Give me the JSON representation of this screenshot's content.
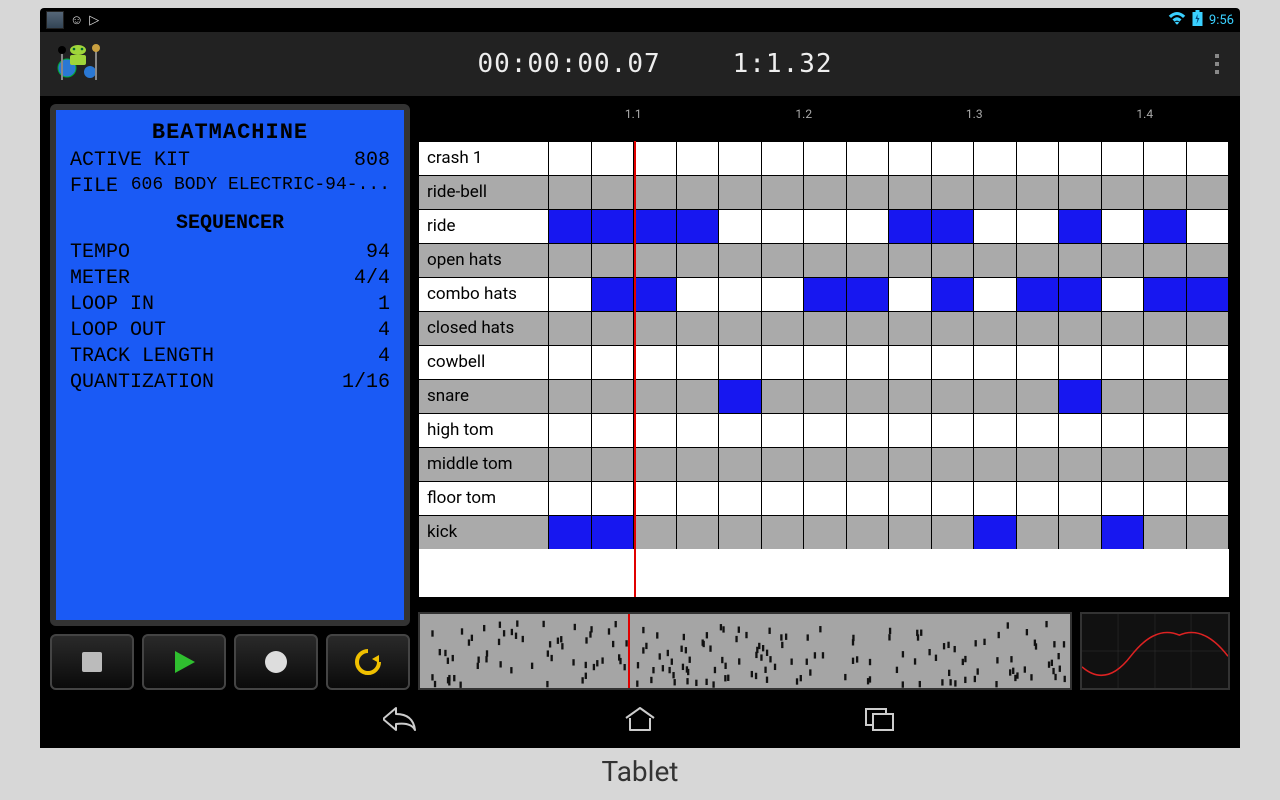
{
  "caption": "Tablet",
  "statusbar": {
    "time": "9:56"
  },
  "actionbar": {
    "elapsed": "00:00:00.07",
    "position": "1:1.32"
  },
  "lcd": {
    "title": "BEATMACHINE",
    "active_kit_label": "ACTIVE KIT",
    "active_kit_value": "808",
    "file_label": "FILE",
    "file_value": "606 BODY ELECTRIC-94-...",
    "section2": "SEQUENCER",
    "tempo_label": "TEMPO",
    "tempo_value": "94",
    "meter_label": "METER",
    "meter_value": "4/4",
    "loopin_label": "LOOP IN",
    "loopin_value": "1",
    "loopout_label": "LOOP OUT",
    "loopout_value": "4",
    "tracklen_label": "TRACK LENGTH",
    "tracklen_value": "4",
    "quant_label": "QUANTIZATION",
    "quant_value": "1/16"
  },
  "timeline": {
    "t1": "1.1",
    "t2": "1.2",
    "t3": "1.3",
    "t4": "1.4"
  },
  "tracks": {
    "r0": "crash 1",
    "r1": "ride-bell",
    "r2": "ride",
    "r3": "open hats",
    "r4": "combo hats",
    "r5": "closed hats",
    "r6": "cowbell",
    "r7": "snare",
    "r8": "high tom",
    "r9": "middle tom",
    "r10": "floor tom",
    "r11": "kick"
  },
  "chart_data": {
    "type": "table",
    "title": "Drum sequencer pattern (1 bar, 1/16 resolution)",
    "columns_per_beat": 4,
    "beats": 4,
    "steps": 16,
    "tracks": [
      {
        "name": "crash 1",
        "steps": [
          0,
          0,
          0,
          0,
          0,
          0,
          0,
          0,
          0,
          0,
          0,
          0,
          0,
          0,
          0,
          0
        ]
      },
      {
        "name": "ride-bell",
        "steps": [
          0,
          0,
          0,
          0,
          0,
          0,
          0,
          0,
          0,
          0,
          0,
          0,
          0,
          0,
          0,
          0
        ]
      },
      {
        "name": "ride",
        "steps": [
          1,
          1,
          1,
          1,
          0,
          0,
          0,
          0,
          1,
          1,
          0,
          0,
          1,
          0,
          1,
          0
        ]
      },
      {
        "name": "open hats",
        "steps": [
          0,
          0,
          0,
          0,
          0,
          0,
          0,
          0,
          0,
          0,
          0,
          0,
          0,
          0,
          0,
          0
        ]
      },
      {
        "name": "combo hats",
        "steps": [
          0,
          1,
          1,
          0,
          0,
          0,
          1,
          1,
          0,
          1,
          0,
          1,
          1,
          0,
          1,
          1
        ]
      },
      {
        "name": "closed hats",
        "steps": [
          0,
          0,
          0,
          0,
          0,
          0,
          0,
          0,
          0,
          0,
          0,
          0,
          0,
          0,
          0,
          0
        ]
      },
      {
        "name": "cowbell",
        "steps": [
          0,
          0,
          0,
          0,
          0,
          0,
          0,
          0,
          0,
          0,
          0,
          0,
          0,
          0,
          0,
          0
        ]
      },
      {
        "name": "snare",
        "steps": [
          0,
          0,
          0,
          0,
          1,
          0,
          0,
          0,
          0,
          0,
          0,
          0,
          1,
          0,
          0,
          0
        ]
      },
      {
        "name": "high tom",
        "steps": [
          0,
          0,
          0,
          0,
          0,
          0,
          0,
          0,
          0,
          0,
          0,
          0,
          0,
          0,
          0,
          0
        ]
      },
      {
        "name": "middle tom",
        "steps": [
          0,
          0,
          0,
          0,
          0,
          0,
          0,
          0,
          0,
          0,
          0,
          0,
          0,
          0,
          0,
          0
        ]
      },
      {
        "name": "floor tom",
        "steps": [
          0,
          0,
          0,
          0,
          0,
          0,
          0,
          0,
          0,
          0,
          0,
          0,
          0,
          0,
          0,
          0
        ]
      },
      {
        "name": "kick",
        "steps": [
          1,
          1,
          0,
          0,
          0,
          0,
          0,
          0,
          0,
          0,
          1,
          0,
          0,
          1,
          0,
          0
        ]
      }
    ],
    "playhead_step": 2,
    "tempo_bpm": 94,
    "meter": "4/4"
  }
}
